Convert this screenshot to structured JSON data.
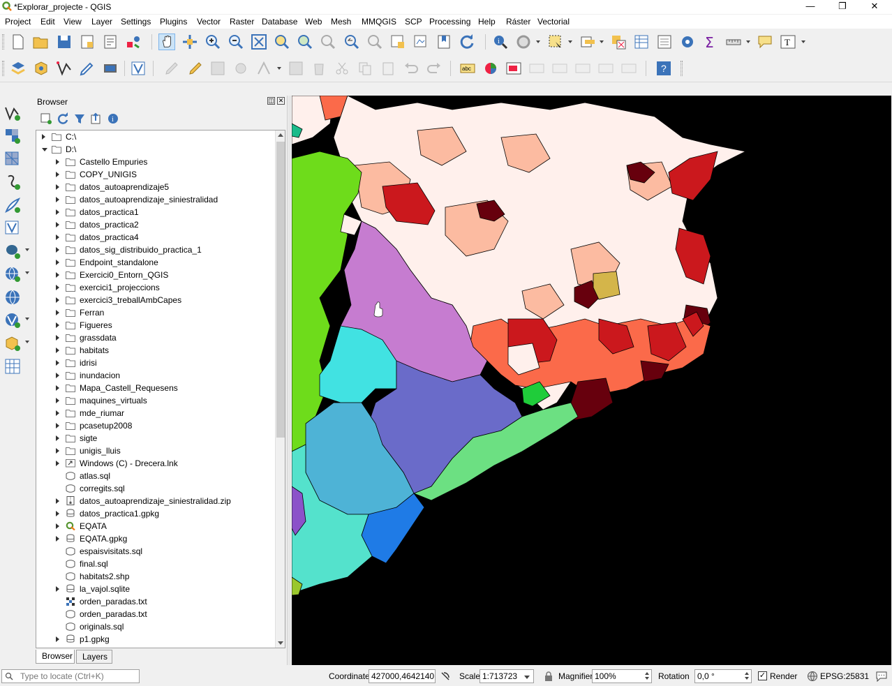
{
  "window": {
    "title": "*Explorar_projecte - QGIS"
  },
  "menu": [
    "Project",
    "Edit",
    "View",
    "Layer",
    "Settings",
    "Plugins",
    "Vector",
    "Raster",
    "Database",
    "Web",
    "Mesh",
    "MMQGIS",
    "SCP",
    "Processing",
    "Help",
    "Ráster",
    "Vectorial"
  ],
  "browser": {
    "title": "Browser",
    "tree": [
      {
        "label": "C:\\",
        "indent": 0,
        "arrow": "r",
        "icon": "folder"
      },
      {
        "label": "D:\\",
        "indent": 0,
        "arrow": "d",
        "icon": "folder"
      },
      {
        "label": "Castello Empuries",
        "indent": 1,
        "arrow": "r",
        "icon": "folder"
      },
      {
        "label": "COPY_UNIGIS",
        "indent": 1,
        "arrow": "r",
        "icon": "folder"
      },
      {
        "label": "datos_autoaprendizaje5",
        "indent": 1,
        "arrow": "r",
        "icon": "folder"
      },
      {
        "label": "datos_autoaprendizaje_siniestralidad",
        "indent": 1,
        "arrow": "r",
        "icon": "folder"
      },
      {
        "label": "datos_practica1",
        "indent": 1,
        "arrow": "r",
        "icon": "folder"
      },
      {
        "label": "datos_practica2",
        "indent": 1,
        "arrow": "r",
        "icon": "folder"
      },
      {
        "label": "datos_practica4",
        "indent": 1,
        "arrow": "r",
        "icon": "folder"
      },
      {
        "label": "datos_sig_distribuido_practica_1",
        "indent": 1,
        "arrow": "r",
        "icon": "folder"
      },
      {
        "label": "Endpoint_standalone",
        "indent": 1,
        "arrow": "r",
        "icon": "folder"
      },
      {
        "label": "Exercici0_Entorn_QGIS",
        "indent": 1,
        "arrow": "r",
        "icon": "folder"
      },
      {
        "label": "exercici1_projeccions",
        "indent": 1,
        "arrow": "r",
        "icon": "folder"
      },
      {
        "label": "exercici3_treballAmbCapes",
        "indent": 1,
        "arrow": "r",
        "icon": "folder"
      },
      {
        "label": "Ferran",
        "indent": 1,
        "arrow": "r",
        "icon": "folder"
      },
      {
        "label": "Figueres",
        "indent": 1,
        "arrow": "r",
        "icon": "folder"
      },
      {
        "label": "grassdata",
        "indent": 1,
        "arrow": "r",
        "icon": "folder"
      },
      {
        "label": "habitats",
        "indent": 1,
        "arrow": "r",
        "icon": "folder"
      },
      {
        "label": "idrisi",
        "indent": 1,
        "arrow": "r",
        "icon": "folder"
      },
      {
        "label": "inundacion",
        "indent": 1,
        "arrow": "r",
        "icon": "folder"
      },
      {
        "label": "Mapa_Castell_Requesens",
        "indent": 1,
        "arrow": "r",
        "icon": "folder"
      },
      {
        "label": "maquines_virtuals",
        "indent": 1,
        "arrow": "r",
        "icon": "folder"
      },
      {
        "label": "mde_riumar",
        "indent": 1,
        "arrow": "r",
        "icon": "folder"
      },
      {
        "label": "pcasetup2008",
        "indent": 1,
        "arrow": "r",
        "icon": "folder"
      },
      {
        "label": "sigte",
        "indent": 1,
        "arrow": "r",
        "icon": "folder"
      },
      {
        "label": "unigis_lluis",
        "indent": 1,
        "arrow": "r",
        "icon": "folder"
      },
      {
        "label": "Windows (C) - Drecera.lnk",
        "indent": 1,
        "arrow": "r",
        "icon": "link"
      },
      {
        "label": "atlas.sql",
        "indent": 1,
        "arrow": "",
        "icon": "vector"
      },
      {
        "label": "corregits.sql",
        "indent": 1,
        "arrow": "",
        "icon": "vector"
      },
      {
        "label": "datos_autoaprendizaje_siniestralidad.zip",
        "indent": 1,
        "arrow": "r",
        "icon": "zip"
      },
      {
        "label": "datos_practica1.gpkg",
        "indent": 1,
        "arrow": "r",
        "icon": "db"
      },
      {
        "label": "EQATA",
        "indent": 1,
        "arrow": "r",
        "icon": "qgis"
      },
      {
        "label": "EQATA.gpkg",
        "indent": 1,
        "arrow": "r",
        "icon": "db"
      },
      {
        "label": "espaisvisitats.sql",
        "indent": 1,
        "arrow": "",
        "icon": "vector"
      },
      {
        "label": "final.sql",
        "indent": 1,
        "arrow": "",
        "icon": "vector"
      },
      {
        "label": "habitats2.shp",
        "indent": 1,
        "arrow": "",
        "icon": "vector"
      },
      {
        "label": "la_vajol.sqlite",
        "indent": 1,
        "arrow": "r",
        "icon": "db"
      },
      {
        "label": "orden_paradas.txt",
        "indent": 1,
        "arrow": "",
        "icon": "raster"
      },
      {
        "label": "orden_paradas.txt",
        "indent": 1,
        "arrow": "",
        "icon": "vector"
      },
      {
        "label": "originals.sql",
        "indent": 1,
        "arrow": "",
        "icon": "vector"
      },
      {
        "label": "p1.gpkg",
        "indent": 1,
        "arrow": "r",
        "icon": "db"
      }
    ],
    "tabs": [
      "Browser",
      "Layers"
    ]
  },
  "status": {
    "locate_placeholder": "Type to locate (Ctrl+K)",
    "coordinate_label": "Coordinate",
    "coordinate": "427000,4642140",
    "scale_label": "Scale",
    "scale": "1:713723",
    "magnifier_label": "Magnifier",
    "magnifier": "100%",
    "rotation_label": "Rotation",
    "rotation": "0,0 °",
    "render_label": "Render",
    "crs": "EPSG:25831"
  },
  "colors": {
    "map_bg": "#000000",
    "choropleth": [
      "#fff0ec",
      "#fcbba1",
      "#fb6a4a",
      "#cb181d",
      "#67000d"
    ]
  }
}
